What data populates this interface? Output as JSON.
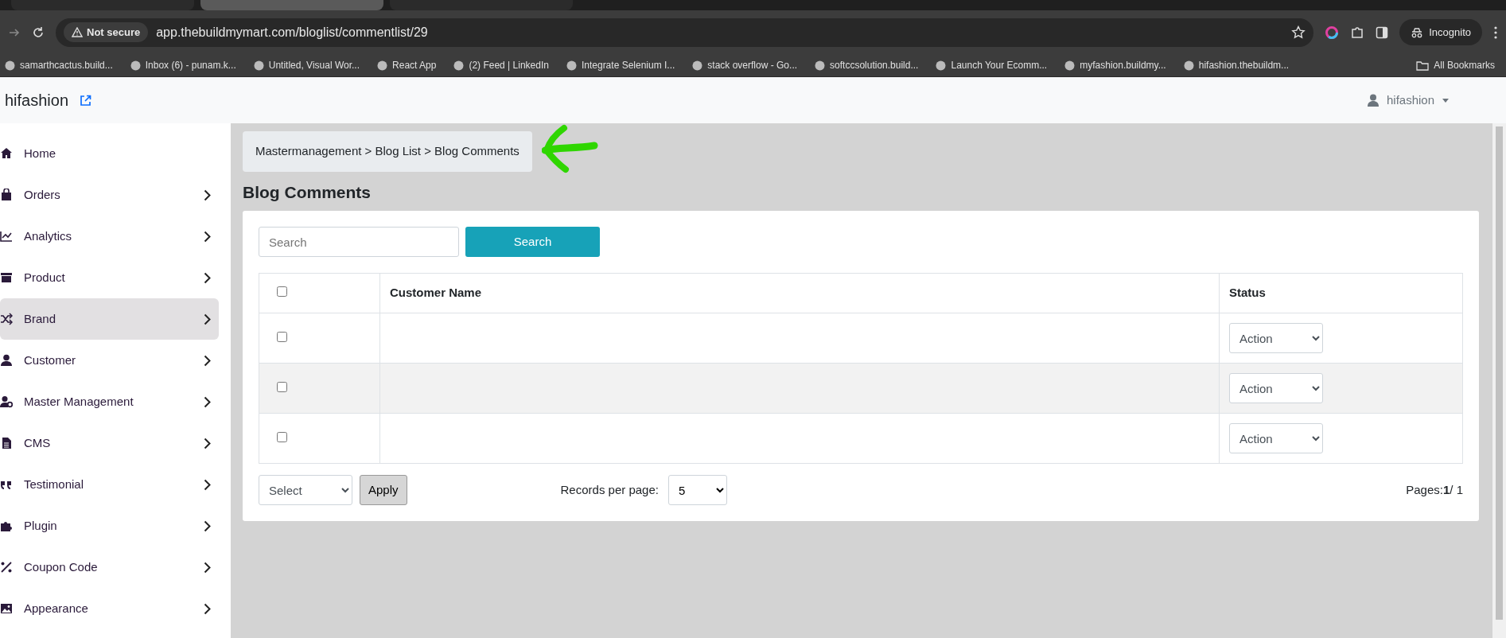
{
  "browser": {
    "tabs": [
      {
        "selected": false
      },
      {
        "selected": true
      },
      {
        "selected": false
      }
    ],
    "security": "Not secure",
    "url": "app.thebuildmymart.com/bloglist/commentlist/29",
    "profile": "Incognito",
    "bookmarks": [
      "samarthcactus.build...",
      "Inbox (6) - punam.k...",
      "Untitled, Visual Wor...",
      "React App",
      "(2) Feed | LinkedIn",
      "Integrate Selenium I...",
      "stack overflow - Go...",
      "softccsolution.build...",
      "Launch Your Ecomm...",
      "myfashion.buildmy...",
      "hifashion.thebuildm..."
    ],
    "all_bookmarks": "All Bookmarks"
  },
  "app": {
    "brand": "hifashion",
    "user": "hifashion"
  },
  "sidebar": {
    "items": [
      {
        "label": "Home",
        "has_submenu": false,
        "selected": false
      },
      {
        "label": "Orders",
        "has_submenu": true,
        "selected": false
      },
      {
        "label": "Analytics",
        "has_submenu": true,
        "selected": false
      },
      {
        "label": "Product",
        "has_submenu": true,
        "selected": false
      },
      {
        "label": "Brand",
        "has_submenu": true,
        "selected": true
      },
      {
        "label": "Customer",
        "has_submenu": true,
        "selected": false
      },
      {
        "label": "Master Management",
        "has_submenu": true,
        "selected": false
      },
      {
        "label": "CMS",
        "has_submenu": true,
        "selected": false
      },
      {
        "label": "Testimonial",
        "has_submenu": true,
        "selected": false
      },
      {
        "label": "Plugin",
        "has_submenu": true,
        "selected": false
      },
      {
        "label": "Coupon Code",
        "has_submenu": true,
        "selected": false
      },
      {
        "label": "Appearance",
        "has_submenu": true,
        "selected": false
      }
    ]
  },
  "breadcrumb": "Mastermanagement > Blog List > Blog Comments",
  "page_title": "Blog Comments",
  "search": {
    "placeholder": "Search",
    "button": "Search"
  },
  "table": {
    "header_checked": false,
    "columns": [
      "Customer Name",
      "Status"
    ],
    "rows": [
      {
        "checked": false,
        "status": "Action"
      },
      {
        "checked": false,
        "status": "Action"
      },
      {
        "checked": false,
        "status": "Action"
      }
    ]
  },
  "footer": {
    "bulk_select": "Select",
    "apply": "Apply",
    "records_label": "Records per page:",
    "records_value": "5",
    "pages": "Pages:**1**/ 1"
  }
}
